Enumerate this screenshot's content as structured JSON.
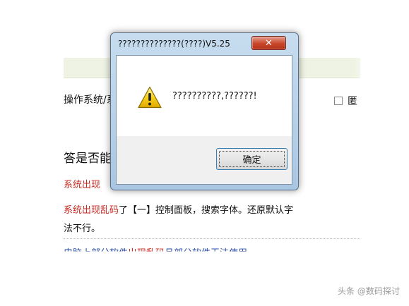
{
  "background": {
    "line1": "操作系统/系",
    "line2": "答是否能",
    "line3": "系统出现",
    "line4_red": "系统出现乱码",
    "line4_rest": "了【一】控制面板，搜索字体。还原默认字",
    "line5": "法不行。",
    "line6_blue1": "电脑上部分软件",
    "line6_red": "出现乱码",
    "line6_blue2": "且部分软件无法使用",
    "right_char": "匿",
    "watermark": "头条 @数码探讨"
  },
  "dialog": {
    "title": "??????????????(????)V5.25",
    "close_symbol": "✕",
    "message": "??????????,??????!",
    "ok_label": "确定",
    "icon": "warning-icon"
  }
}
